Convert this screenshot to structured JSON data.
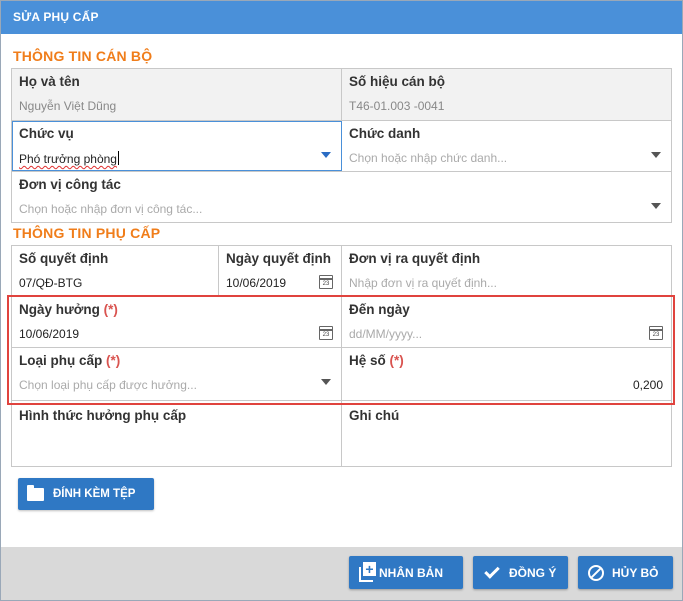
{
  "dialog": {
    "title": "SỬA PHỤ CẤP"
  },
  "sections": {
    "staff": "THÔNG TIN CÁN BỘ",
    "allowance": "THÔNG TIN PHỤ CẤP"
  },
  "staff": {
    "full_name": {
      "label": "Họ và tên",
      "value": "Nguyễn Việt Dũng"
    },
    "staff_code": {
      "label": "Số hiệu cán bộ",
      "value": "T46-01.003 -0041"
    },
    "position": {
      "label": "Chức vụ",
      "value": "Phó trưởng phòng"
    },
    "title": {
      "label": "Chức danh",
      "placeholder": "Chọn hoặc nhập chức danh..."
    },
    "unit": {
      "label": "Đơn vị công tác",
      "placeholder": "Chọn hoặc nhập đơn vị công tác..."
    }
  },
  "allowance": {
    "decision_no": {
      "label": "Số quyết định",
      "value": "07/QĐ-BTG"
    },
    "decision_date": {
      "label": "Ngày quyết định",
      "value": "10/06/2019"
    },
    "issuer": {
      "label": "Đơn vị ra quyết định",
      "placeholder": "Nhập đơn vị ra quyết định..."
    },
    "start_date": {
      "label": "Ngày hưởng",
      "required": "(*)",
      "value": "10/06/2019"
    },
    "end_date": {
      "label": "Đến ngày",
      "placeholder": "dd/MM/yyyy..."
    },
    "type": {
      "label": "Loại phụ cấp",
      "required": "(*)",
      "placeholder": "Chọn loại phụ cấp được hưởng..."
    },
    "coefficient": {
      "label": "Hệ số",
      "required": "(*)",
      "value": "0,200"
    },
    "form": {
      "label": "Hình thức hưởng phụ cấp"
    },
    "note": {
      "label": "Ghi chú"
    }
  },
  "buttons": {
    "attach": "ĐÍNH KÈM TỆP",
    "duplicate": "NHÂN BẢN",
    "agree": "ĐỒNG Ý",
    "cancel": "HỦY BỎ"
  },
  "colors": {
    "header": "#4a90d9",
    "section_title": "#f07d1a",
    "button": "#2f78c4",
    "required": "#d9534f",
    "highlight_border": "#e0433e"
  }
}
